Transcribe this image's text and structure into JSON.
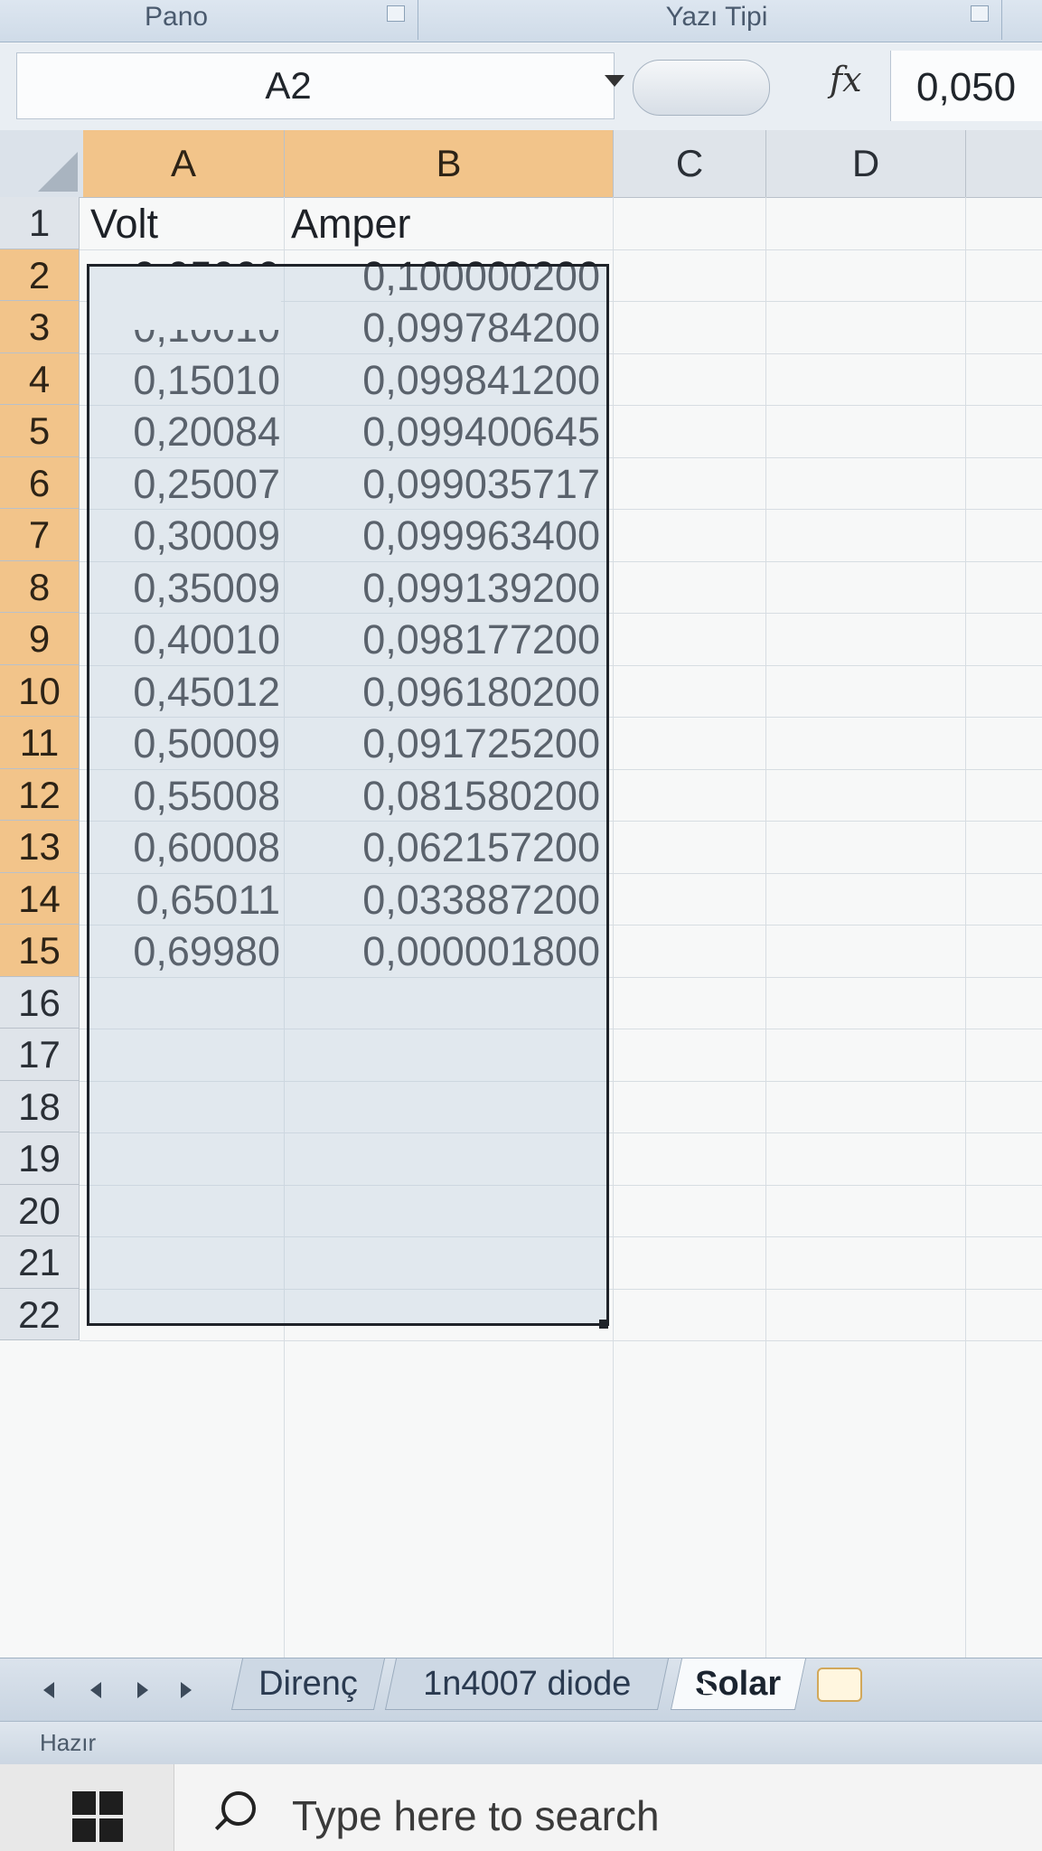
{
  "ribbon": {
    "groups": [
      {
        "label": "Pano"
      },
      {
        "label": "Yazı Tipi"
      }
    ]
  },
  "formula_bar": {
    "name_box": "A2",
    "fx": "fx",
    "value": "0,050"
  },
  "columns": [
    "A",
    "B",
    "C",
    "D"
  ],
  "rows": [
    {
      "num": "1",
      "a": "Volt",
      "b": "Amper"
    },
    {
      "num": "2",
      "a": "0,05009",
      "b": "0,100000200"
    },
    {
      "num": "3",
      "a": "0,10010",
      "b": "0,099784200"
    },
    {
      "num": "4",
      "a": "0,15010",
      "b": "0,099841200"
    },
    {
      "num": "5",
      "a": "0,20084",
      "b": "0,099400645"
    },
    {
      "num": "6",
      "a": "0,25007",
      "b": "0,099035717"
    },
    {
      "num": "7",
      "a": "0,30009",
      "b": "0,099963400"
    },
    {
      "num": "8",
      "a": "0,35009",
      "b": "0,099139200"
    },
    {
      "num": "9",
      "a": "0,40010",
      "b": "0,098177200"
    },
    {
      "num": "10",
      "a": "0,45012",
      "b": "0,096180200"
    },
    {
      "num": "11",
      "a": "0,50009",
      "b": "0,091725200"
    },
    {
      "num": "12",
      "a": "0,55008",
      "b": "0,081580200"
    },
    {
      "num": "13",
      "a": "0,60008",
      "b": "0,062157200"
    },
    {
      "num": "14",
      "a": "0,65011",
      "b": "0,033887200"
    },
    {
      "num": "15",
      "a": "0,69980",
      "b": "0,000001800"
    },
    {
      "num": "16",
      "a": "",
      "b": ""
    },
    {
      "num": "17",
      "a": "",
      "b": ""
    },
    {
      "num": "18",
      "a": "",
      "b": ""
    },
    {
      "num": "19",
      "a": "",
      "b": ""
    },
    {
      "num": "20",
      "a": "",
      "b": ""
    },
    {
      "num": "21",
      "a": "",
      "b": ""
    },
    {
      "num": "22",
      "a": "",
      "b": ""
    }
  ],
  "sheet_tabs": [
    {
      "label": "Direnç",
      "active": false
    },
    {
      "label": "1n4007 diode",
      "active": false
    },
    {
      "label": "Solar",
      "active": true
    }
  ],
  "status_bar": {
    "text": "Hazır"
  },
  "taskbar": {
    "search_placeholder": "Type here to search"
  },
  "colors": {
    "selected_header": "#f2c48a",
    "selection_fill": "#bfcfe0"
  }
}
